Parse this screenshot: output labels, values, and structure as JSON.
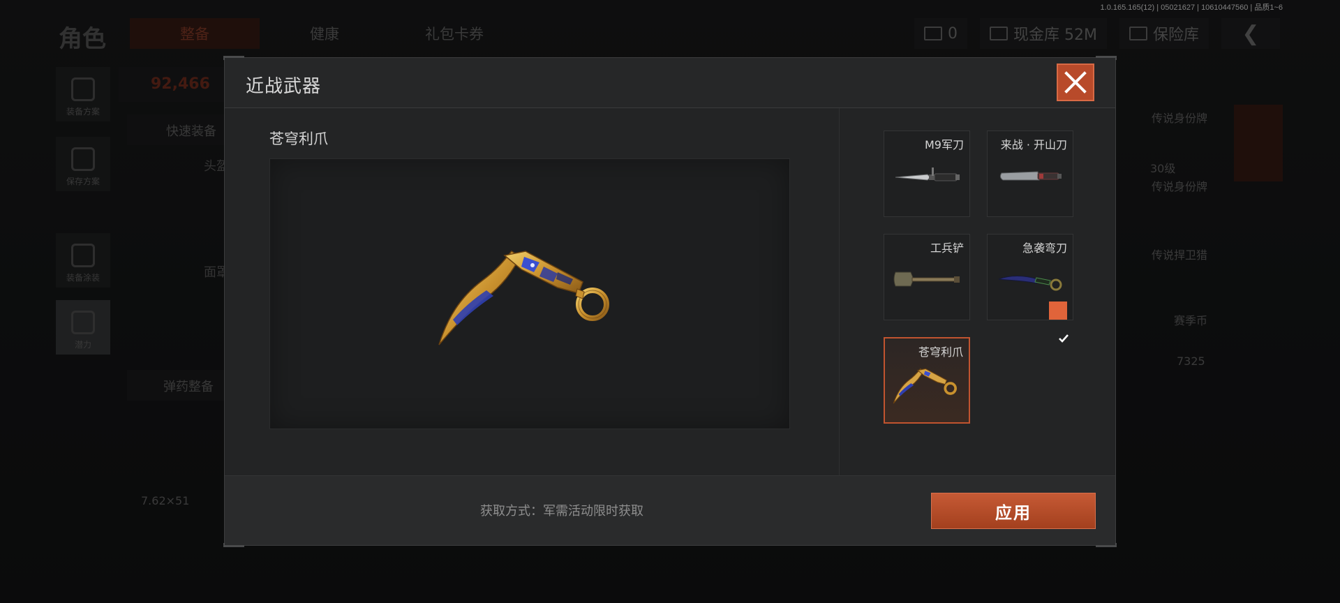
{
  "version": "1.0.165.165(12) | 05021627 | 10610447560 | 品质1~6",
  "background": {
    "title": "角色",
    "tabs": [
      "整备",
      "健康",
      "礼包卡券"
    ],
    "currency_count": "0",
    "cash_vault": "现金库 52M",
    "safe_vault": "保险库",
    "side_buttons": [
      "装备方案",
      "保存方案",
      "装备涂装",
      "潜力"
    ],
    "value": "92,466",
    "quick_equip": "快速装备",
    "ammo_prep": "弹药整备",
    "caliber": "7.62×51",
    "slot_labels": [
      "头盔",
      "面罩"
    ],
    "right_items": [
      "传说身份牌",
      "传说身份牌",
      "传说捍卫猎",
      "赛季币"
    ],
    "right_level": "30级",
    "coin_count": "7325"
  },
  "modal": {
    "title": "近战武器",
    "selected_name": "苍穹利爪",
    "acquire_text": "获取方式：军需活动限时获取",
    "apply_label": "应用",
    "items": [
      {
        "name": "M9军刀",
        "icon": "bayonet-icon",
        "equipped": false,
        "selected": false
      },
      {
        "name": "来战 · 开山刀",
        "icon": "machete-icon",
        "equipped": false,
        "selected": false
      },
      {
        "name": "工兵铲",
        "icon": "shovel-icon",
        "equipped": false,
        "selected": false
      },
      {
        "name": "急袭弯刀",
        "icon": "karambit-icon",
        "equipped": true,
        "selected": false
      },
      {
        "name": "苍穹利爪",
        "icon": "gold-karambit-icon",
        "equipped": false,
        "selected": true
      }
    ]
  },
  "colors": {
    "accent": "#c1542f",
    "apply_button": "#b44a26",
    "check_badge": "#e0643a"
  }
}
